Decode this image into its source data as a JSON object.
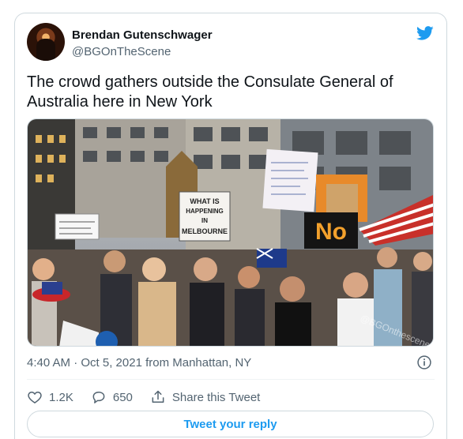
{
  "tweet": {
    "author_name": "Brendan Gutenschwager",
    "author_handle": "@BGOnTheScene",
    "text": "The crowd gathers outside the Consulate General of Australia here in New York",
    "media": {
      "signs": [
        "WHAT IS HAPPENING IN MELBOURNE",
        "No"
      ],
      "watermark": "@BGOnthescene"
    },
    "timestamp": "4:40 AM · Oct 5, 2021 from Manhattan, NY",
    "likes": "1.2K",
    "replies": "650",
    "share_label": "Share this Tweet",
    "reply_button_label": "Tweet your reply"
  },
  "icons": {
    "brand": "twitter-bird-icon",
    "info": "info-icon",
    "like": "heart-icon",
    "reply": "reply-bubble-icon",
    "share": "share-icon"
  },
  "colors": {
    "accent": "#1d9bf0",
    "secondary_text": "#536471",
    "border": "#cfd9de"
  }
}
